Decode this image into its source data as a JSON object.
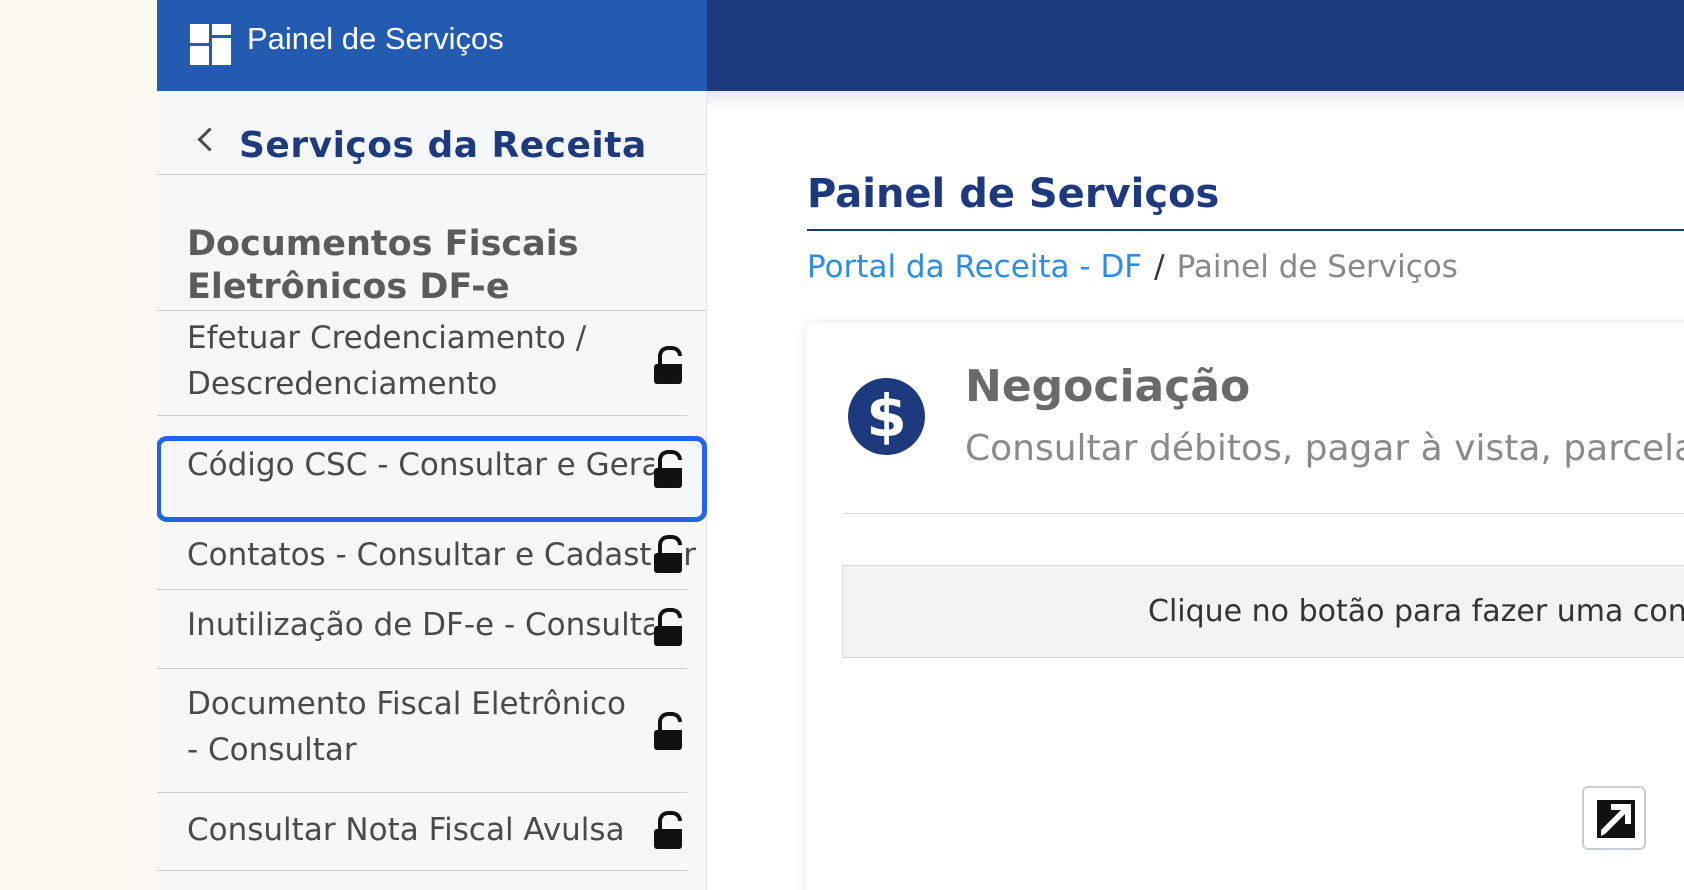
{
  "header": {
    "title": "Painel de Serviços"
  },
  "sidebar": {
    "back_label": "Serviços da Receita",
    "section_title": "Documentos Fiscais Eletrônicos DF-e",
    "items": [
      {
        "label": "Efetuar Credenciamento / Descredenciamento",
        "icon": "unlock-icon"
      },
      {
        "label": "Código CSC - Consultar e Gerar",
        "icon": "unlock-icon"
      },
      {
        "label": "Contatos - Consultar e Cadastrar",
        "icon": "unlock-icon"
      },
      {
        "label": "Inutilização de DF-e - Consultar",
        "icon": "unlock-icon"
      },
      {
        "label": "Documento Fiscal Eletrônico - Consultar",
        "icon": "unlock-icon"
      },
      {
        "label": "Consultar Nota Fiscal Avulsa",
        "icon": "unlock-icon"
      }
    ]
  },
  "main": {
    "page_title": "Painel de Serviços",
    "breadcrumb": {
      "link": "Portal da Receita - DF",
      "separator": "/",
      "current": "Painel de Serviços"
    },
    "card": {
      "icon": "dollar-icon",
      "icon_glyph": "$",
      "title": "Negociação",
      "subtitle": "Consultar débitos, pagar à vista, parcelar",
      "button_text": "Clique no botão para fazer uma consu"
    }
  },
  "colors": {
    "header_dark": "#1e3a7e",
    "header_brand": "#225bb0",
    "highlight": "#1f63f0",
    "link": "#2c8ce6"
  }
}
